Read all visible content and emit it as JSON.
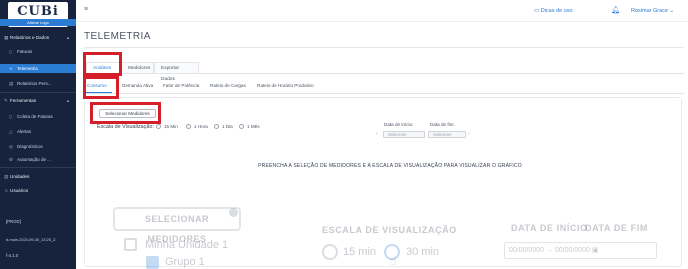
{
  "sidebar": {
    "logo": "CUBi",
    "change_logo": "Alterar Logo",
    "groups": [
      {
        "label": "Relatórios e Dados",
        "items": [
          "Faturas",
          "Telemetria",
          "Relatórios Pers..."
        ]
      },
      {
        "label": "Ferramentas",
        "items": [
          "Coleta de Faturas",
          "Alertas",
          "Diagnósticos",
          "Automação de ..."
        ]
      }
    ],
    "bottom_items": [
      "Unidades",
      "Usuários"
    ],
    "env": "[PROD]",
    "build": "b-main-2024-09-30_13:25_Z",
    "version": "f-4.1.0"
  },
  "topbar": {
    "tips": "Dicas de uso",
    "user": "Rosimar Grace"
  },
  "page": {
    "title": "TELEMETRIA",
    "tabs": [
      "Análises",
      "Medidores",
      "Exportar Dados"
    ],
    "subtabs": [
      "Consumo",
      "Demanda Ativa",
      "Fator de Potência",
      "Rateio de Cargas",
      "Rateio de Horário Produtivo"
    ]
  },
  "controls": {
    "select_button": "Selecionar Medidores",
    "scale_label": "Escala de Visualização:",
    "scale_options": [
      "15 Min",
      "1 Hora",
      "1 Dia",
      "1 Mês"
    ],
    "start_label": "Data de início:",
    "end_label": "Data de fim:",
    "date_placeholder": "Selecione"
  },
  "message": "PREENCHA A SELEÇÃO DE MEDIDORES E A ESCALA DE VISUALIZAÇÃO PARA VISUALIZAR O GRÁFICO",
  "overlay": {
    "select_heading": "SELECIONAR MEDIDORES",
    "unit1": "Minha Unidade 1",
    "group1": "Grupo 1",
    "scale_heading": "ESCALA DE VISUALIZAÇÃO",
    "opt15": "15 min",
    "opt30": "30 min",
    "start_heading": "DATA DE INÍCIO",
    "end_heading": "DATA DE FIM",
    "start_value": "00/00/0000",
    "end_value": "00/00/0000"
  },
  "colors": {
    "sidebar_bg": "#17233d",
    "accent": "#2b7cd3",
    "highlight_box": "#d41f2a"
  }
}
